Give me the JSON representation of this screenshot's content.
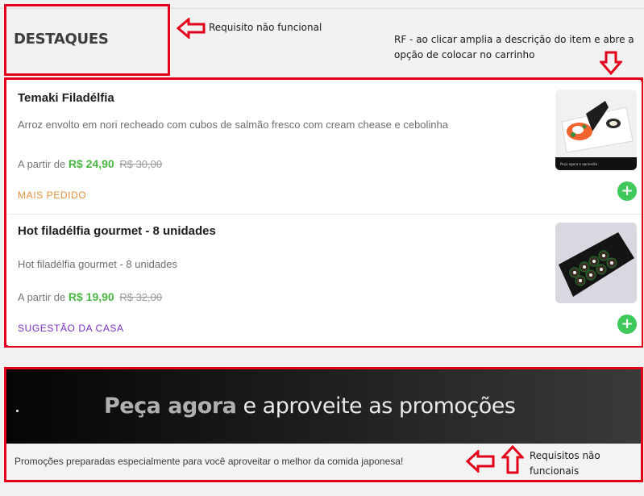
{
  "section": {
    "title": "DESTAQUES"
  },
  "annotations": {
    "rnf_top": "Requisito não funcional",
    "rf": "RF - ao clicar amplia a descrição do item e abre a opção de colocar no carrinho",
    "rnf_bottom": "Requisitos não funcionais"
  },
  "items": [
    {
      "name": "Temaki Filadélfia",
      "description": "Arroz envolto em nori recheado com cubos de salmão fresco com cream chease e cebolinha",
      "price_prefix": "A partir de",
      "price_now": "R$ 24,90",
      "price_old": "R$ 30,00",
      "tag": "MAIS PEDIDO",
      "tag_color": "#e0913a",
      "image_caption": "Peça agora e aproveite",
      "add_label": "+"
    },
    {
      "name": "Hot filadélfia gourmet - 8 unidades",
      "description": "Hot filadélfia gourmet - 8 unidades",
      "price_prefix": "A partir de",
      "price_now": "R$ 19,90",
      "price_old": "R$ 32,00",
      "tag": "SUGESTÃO DA CASA",
      "tag_color": "#7a2fc4",
      "add_label": "+"
    }
  ],
  "promo": {
    "headline_bold": "Peça agora",
    "headline_rest": "e aproveite as promoções",
    "subtext": "Promoções preparadas especialmente para você aproveitar o melhor da comida japonesa!"
  },
  "colors": {
    "annotation_red": "#e2001a",
    "price_green": "#4bb543",
    "add_button_green": "#3ec95a"
  }
}
